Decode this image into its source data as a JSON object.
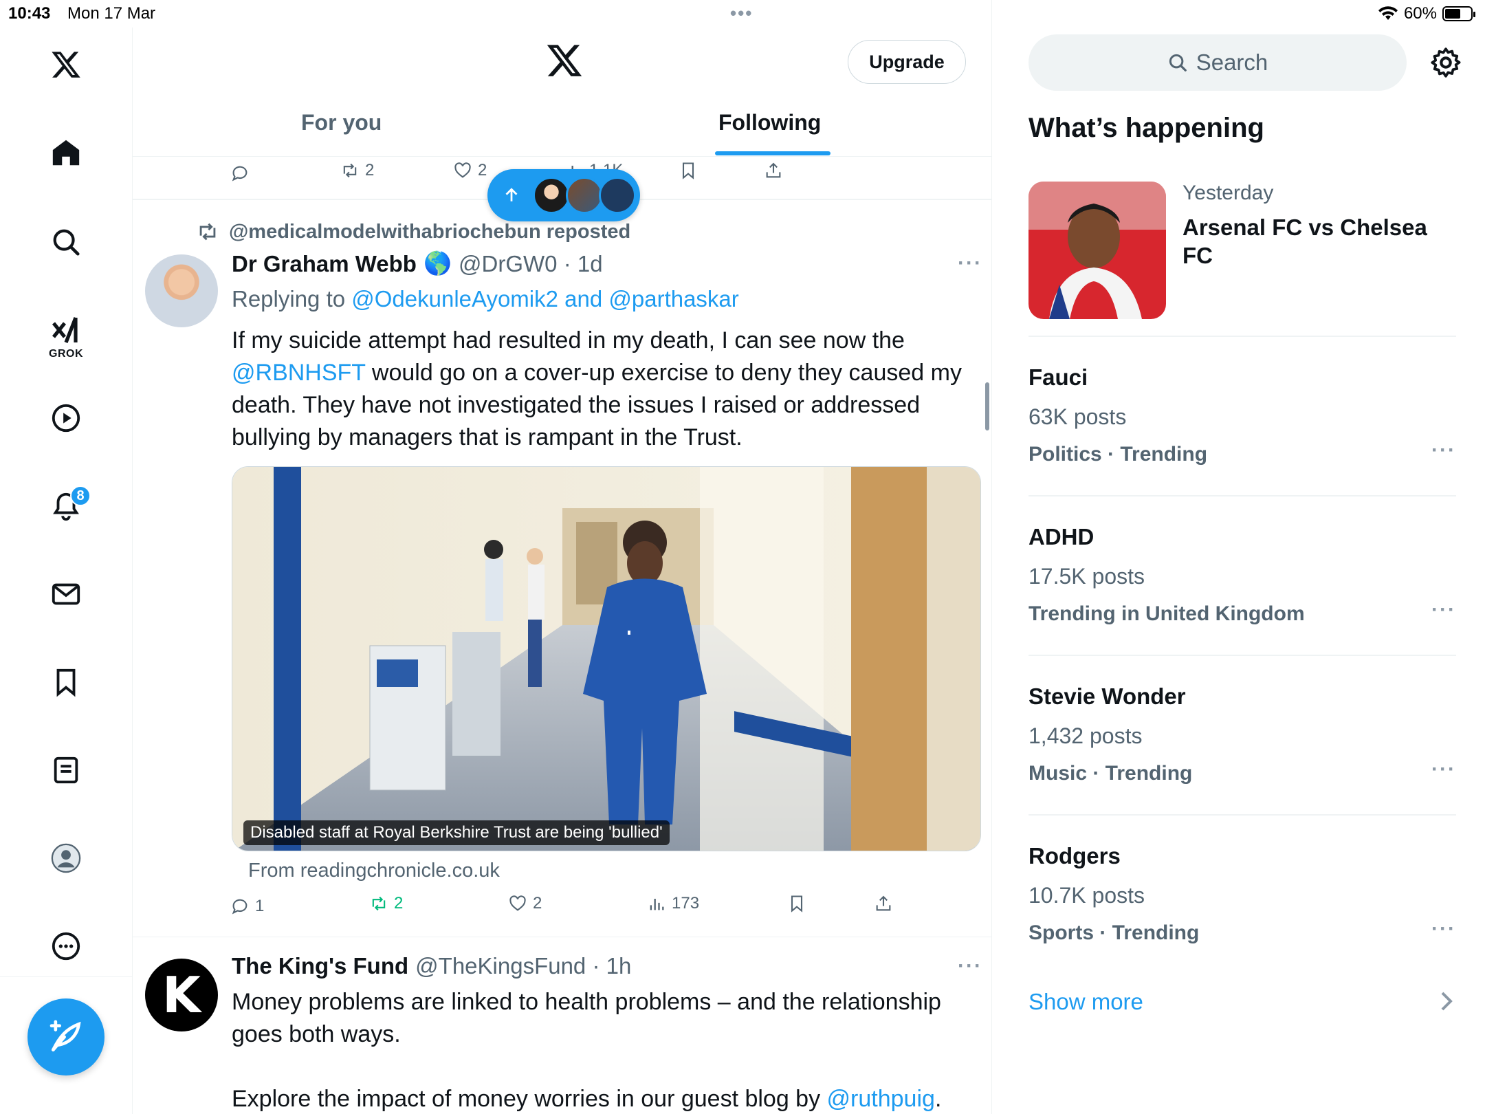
{
  "status": {
    "time": "10:43",
    "date": "Mon 17 Mar",
    "battery": "60%",
    "battery_level": 0.6
  },
  "nav": {
    "grok_label": "GROK",
    "notifications_badge": "8"
  },
  "header": {
    "upgrade_label": "Upgrade",
    "tabs": [
      {
        "label": "For you"
      },
      {
        "label": "Following"
      }
    ]
  },
  "prev_post": {
    "reposts": "2",
    "likes": "2",
    "views": "1.1K"
  },
  "post": {
    "repost_by": "@medicalmodelwithabriochebun reposted",
    "name": "Dr Graham Webb",
    "flag": "🌎",
    "handle_time": "@DrGW0 · 1d",
    "replying_prefix": "Replying to ",
    "reply_handles": "@OdekunleAyomik2 and @parthaskar",
    "text_1": "If my suicide attempt had resulted in my death, I can see now the ",
    "text_mention": "@RBNHSFT",
    "text_2": " would go on a cover-up exercise to deny they caused my death. They have not  investigated the issues I raised or addressed bullying by managers that is rampant in the Trust.",
    "card_caption": "Disabled staff at Royal Berkshire Trust are being 'bullied'",
    "card_source": "From readingchronicle.co.uk",
    "replies": "1",
    "reposts": "2",
    "likes": "2",
    "views": "173"
  },
  "post2": {
    "avatar_letter": "K",
    "name": "The King's Fund",
    "handle_time": "@TheKingsFund · 1h",
    "text_1": "Money problems are linked to health problems – and the relationship goes both ways.",
    "text_2": "Explore the impact of money worries in our guest blog by ",
    "text_mention": "@ruthpuig",
    "text_end": "."
  },
  "right": {
    "search_placeholder": "Search",
    "title": "What’s happening",
    "featured": {
      "when": "Yesterday",
      "title": "Arsenal FC vs Chelsea FC"
    },
    "trends": [
      {
        "name": "Fauci",
        "posts": "63K posts",
        "category": "Politics · Trending"
      },
      {
        "name": "ADHD",
        "posts": "17.5K posts",
        "category": "Trending in United Kingdom"
      },
      {
        "name": "Stevie Wonder",
        "posts": "1,432 posts",
        "category": "Music · Trending"
      },
      {
        "name": "Rodgers",
        "posts": "10.7K posts",
        "category": "Sports · Trending"
      }
    ],
    "show_more": "Show more"
  },
  "colors": {
    "accent": "#1d9bf0",
    "text": "#0f1419",
    "muted": "#536471",
    "repost_green": "#00ba7c"
  }
}
